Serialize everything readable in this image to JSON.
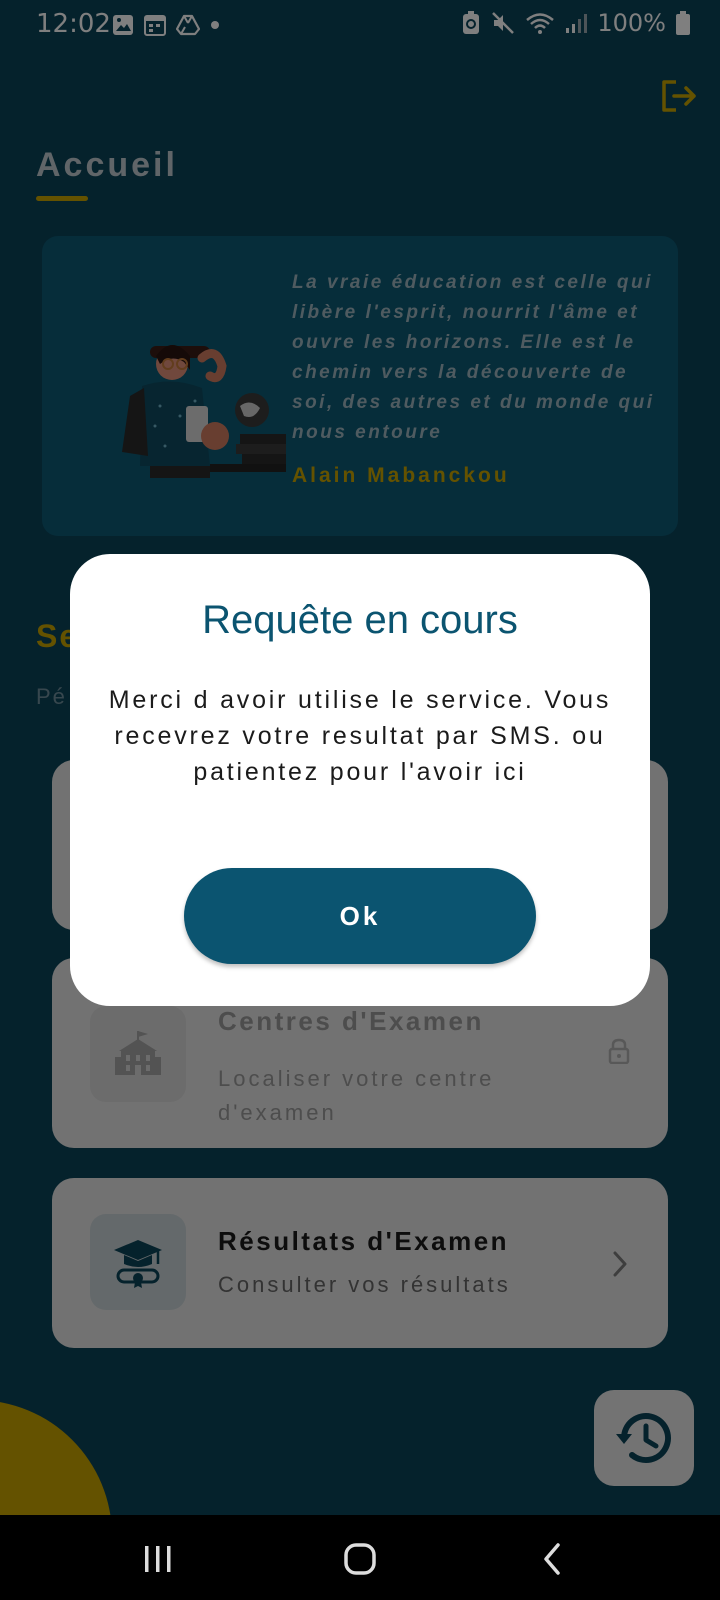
{
  "status": {
    "time": "12:02",
    "battery": "100%"
  },
  "header": {
    "title": "Accueil"
  },
  "quote": {
    "text": "La vraie éducation est celle qui libère l'esprit, nourrit l'âme et ouvre les horizons. Elle est le chemin vers la découverte de soi, des autres et du monde qui nous entoure",
    "author": "Alain Mabanckou"
  },
  "section": {
    "title": "Se",
    "subtitle": "Pé"
  },
  "cards": [
    {
      "title": "Centres d'Examen",
      "description": "Localiser votre centre d'examen",
      "icon": "school-building-icon",
      "locked": true
    },
    {
      "title": "Résultats d'Examen",
      "description": "Consulter vos résultats",
      "icon": "graduation-cap-icon",
      "locked": false
    }
  ],
  "dialog": {
    "title": "Requête en cours",
    "message": "Merci d avoir utilise le service. Vous recevrez votre resultat par SMS. ou patientez pour l'avoir ici",
    "ok_label": "Ok"
  },
  "colors": {
    "primary": "#0b5470",
    "accent": "#c8a400",
    "background": "#0b4459"
  },
  "icons": {
    "logout": "logout-icon",
    "history": "history-icon"
  }
}
